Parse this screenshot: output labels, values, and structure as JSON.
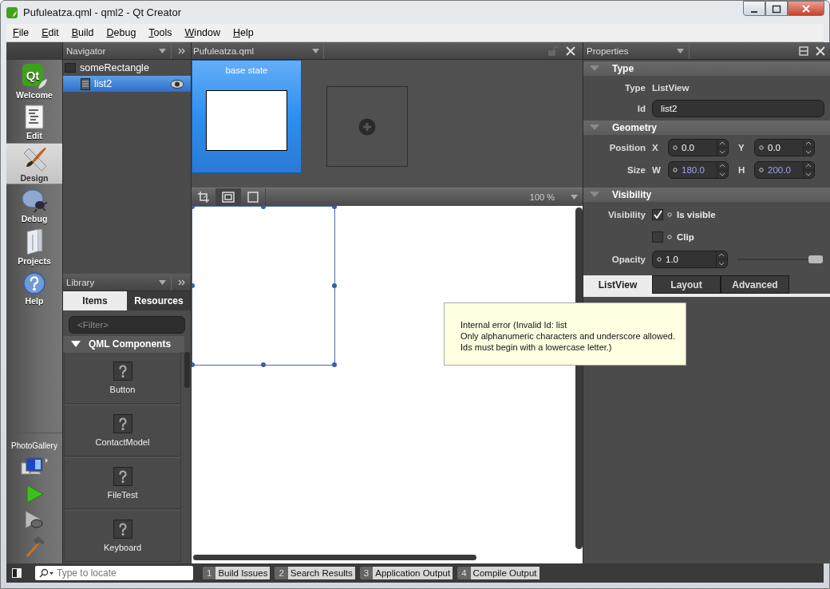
{
  "window": {
    "title": "Pufuleatza.qml - qml2 - Qt Creator"
  },
  "menu": [
    "File",
    "Edit",
    "Build",
    "Debug",
    "Tools",
    "Window",
    "Help"
  ],
  "modes": [
    {
      "label": "Welcome",
      "logo": "Qt",
      "selected": false
    },
    {
      "label": "Edit",
      "selected": false
    },
    {
      "label": "Design",
      "selected": true
    },
    {
      "label": "Debug",
      "selected": false
    },
    {
      "label": "Projects",
      "selected": false
    },
    {
      "label": "Help",
      "selected": false
    }
  ],
  "target": {
    "label": "PhotoGallery"
  },
  "navigator": {
    "title": "Navigator",
    "tree": [
      {
        "label": "someRectangle",
        "kind": "rectangle",
        "selected": false,
        "children": [
          {
            "label": "list2",
            "kind": "list",
            "selected": true
          }
        ]
      }
    ]
  },
  "library": {
    "title": "Library",
    "tabs": [
      {
        "label": "Items",
        "selected": true
      },
      {
        "label": "Resources",
        "selected": false
      }
    ],
    "filter": {
      "placeholder": "<Filter>"
    },
    "section": {
      "title": "QML Components",
      "expanded": true,
      "items": [
        "Button",
        "ContactModel",
        "FileTest",
        "Keyboard"
      ]
    }
  },
  "editor": {
    "file": "Pufuleatza.qml",
    "states": [
      {
        "label": "base state",
        "selected": true
      }
    ],
    "zoom": "100 %",
    "tooltip": [
      "Internal error (Invalid Id: list",
      "Only alphanumeric characters and underscore allowed.",
      "Ids must begin with a lowercase letter.)"
    ]
  },
  "properties": {
    "title": "Properties",
    "type_section": {
      "title": "Type",
      "expanded": true,
      "type_label": "Type",
      "type_value": "ListView",
      "id_label": "Id",
      "id_value": "list2"
    },
    "geometry": {
      "title": "Geometry",
      "expanded": true,
      "rows": [
        {
          "label": "Position",
          "fields": [
            {
              "axis": "X",
              "value": "0.0",
              "modified": false
            },
            {
              "axis": "Y",
              "value": "0.0",
              "modified": false
            }
          ]
        },
        {
          "label": "Size",
          "fields": [
            {
              "axis": "W",
              "value": "180.0",
              "modified": true
            },
            {
              "axis": "H",
              "value": "200.0",
              "modified": true
            }
          ]
        }
      ]
    },
    "visibility": {
      "title": "Visibility",
      "expanded": true,
      "label": "Visibility",
      "checks": [
        {
          "label": "Is visible",
          "checked": true
        },
        {
          "label": "Clip",
          "checked": false
        }
      ],
      "opacity": {
        "label": "Opacity",
        "value": "1.0",
        "level": 1
      }
    },
    "tabs": [
      {
        "label": "ListView",
        "selected": true
      },
      {
        "label": "Layout",
        "selected": false
      },
      {
        "label": "Advanced",
        "selected": false
      }
    ]
  },
  "status_bar": {
    "locate": {
      "placeholder": "Type to locate"
    },
    "panes": [
      {
        "number": "1",
        "label": "Build Issues"
      },
      {
        "number": "2",
        "label": "Search Results"
      },
      {
        "number": "3",
        "label": "Application Output"
      },
      {
        "number": "4",
        "label": "Compile Output"
      }
    ]
  }
}
